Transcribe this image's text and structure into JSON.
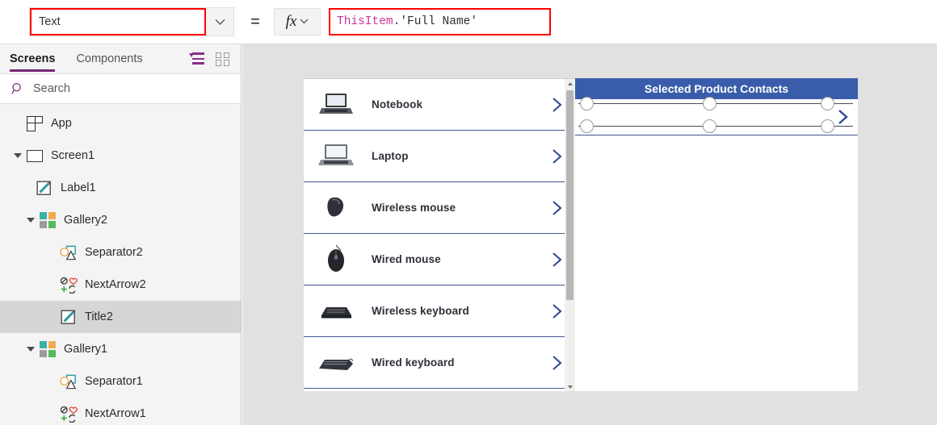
{
  "formula_bar": {
    "property_value": "Text",
    "property_caret_icon": "chevron-down-icon",
    "equals": "=",
    "fx_label": "fx",
    "fx_caret_icon": "chevron-down-icon",
    "formula_token_identifier": "ThisItem",
    "formula_token_rest": ".'Full Name'",
    "formula_full": "ThisItem.'Full Name'",
    "highlight_color": "#ff0000",
    "identifier_color": "#cc3399"
  },
  "sidebar": {
    "tabs": [
      {
        "label": "Screens",
        "active": true
      },
      {
        "label": "Components",
        "active": false
      }
    ],
    "active_tab_accent": "#742774",
    "tools": [
      {
        "name": "list-view-icon"
      },
      {
        "name": "thumbnail-view-icon"
      }
    ],
    "search": {
      "placeholder": "Search",
      "icon": "search-icon"
    },
    "tree": [
      {
        "label": "App",
        "icon": "app-icon",
        "level": 0,
        "twisty": "none",
        "selected": false
      },
      {
        "label": "Screen1",
        "icon": "screen-icon",
        "level": 0,
        "twisty": "open",
        "selected": false
      },
      {
        "label": "Label1",
        "icon": "label-icon",
        "level": 2,
        "twisty": "none",
        "selected": false
      },
      {
        "label": "Gallery2",
        "icon": "gallery-icon",
        "level": 1,
        "twisty": "open",
        "selected": false
      },
      {
        "label": "Separator2",
        "icon": "separator-icon",
        "level": 3,
        "twisty": "none",
        "selected": false
      },
      {
        "label": "NextArrow2",
        "icon": "next-arrow-icon",
        "level": 3,
        "twisty": "none",
        "selected": false
      },
      {
        "label": "Title2",
        "icon": "label-icon",
        "level": 3,
        "twisty": "none",
        "selected": true
      },
      {
        "label": "Gallery1",
        "icon": "gallery-icon",
        "level": 1,
        "twisty": "open",
        "selected": false
      },
      {
        "label": "Separator1",
        "icon": "separator-icon",
        "level": 3,
        "twisty": "none",
        "selected": false
      },
      {
        "label": "NextArrow1",
        "icon": "next-arrow-icon",
        "level": 3,
        "twisty": "none",
        "selected": false
      }
    ]
  },
  "canvas": {
    "background": "#e1e1e1",
    "product_gallery": {
      "name": "Gallery1",
      "chevron_icon": "chevron-right-icon",
      "chevron_color": "#2f4a97",
      "separator_color": "#46568f",
      "items": [
        {
          "label": "Notebook",
          "image": "notebook-image"
        },
        {
          "label": "Laptop",
          "image": "laptop-image"
        },
        {
          "label": "Wireless mouse",
          "image": "wireless-mouse-image"
        },
        {
          "label": "Wired mouse",
          "image": "wired-mouse-image"
        },
        {
          "label": "Wireless keyboard",
          "image": "wireless-keyboard-image"
        },
        {
          "label": "Wired keyboard",
          "image": "wired-keyboard-image"
        }
      ],
      "scrollbar": {
        "up_icon": "scroll-up-arrow-icon",
        "down_icon": "scroll-down-arrow-icon"
      }
    },
    "contacts_gallery": {
      "header_title": "Selected Product Contacts",
      "header_color": "#3a5dab",
      "chevron_icon": "chevron-right-icon",
      "selected_row_label": "",
      "selection_handles": 6
    }
  }
}
